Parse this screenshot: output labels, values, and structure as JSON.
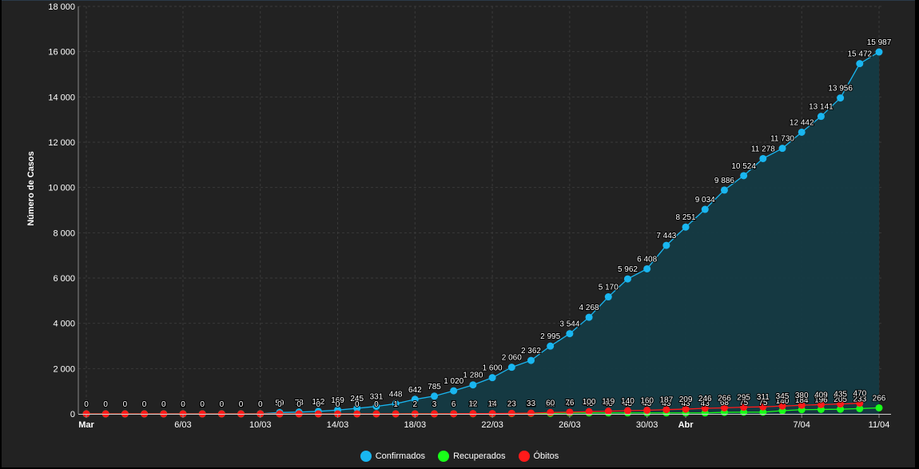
{
  "colors": {
    "background": "#222222",
    "grid": "#3a3a3a",
    "axis_text": "#ffffff",
    "confirmados": "#19b6f0",
    "recuperados": "#19ff19",
    "obitos": "#ff1a1a",
    "area_fill": "#153b44"
  },
  "legend": [
    {
      "name": "Confirmados",
      "color": "#19b6f0"
    },
    {
      "name": "Recuperados",
      "color": "#19ff19"
    },
    {
      "name": "Óbitos",
      "color": "#ff1a1a"
    }
  ],
  "chart_data": {
    "type": "line",
    "ylabel": "Número de Casos",
    "xlabel": "",
    "ylim": [
      0,
      18000
    ],
    "yticks": [
      0,
      2000,
      4000,
      6000,
      8000,
      10000,
      12000,
      14000,
      16000,
      18000
    ],
    "ytick_labels": [
      "0",
      "2 000",
      "4 000",
      "6 000",
      "8 000",
      "10 000",
      "12 000",
      "14 000",
      "16 000",
      "18 000"
    ],
    "x_start": "2020-03-01",
    "x_end": "2020-04-11",
    "xtick_labels": [
      {
        "date": "2020-03-01",
        "label": "Mar",
        "bold": true
      },
      {
        "date": "2020-03-06",
        "label": "6/03",
        "bold": false
      },
      {
        "date": "2020-03-10",
        "label": "10/03",
        "bold": false
      },
      {
        "date": "2020-03-14",
        "label": "14/03",
        "bold": false
      },
      {
        "date": "2020-03-18",
        "label": "18/03",
        "bold": false
      },
      {
        "date": "2020-03-22",
        "label": "22/03",
        "bold": false
      },
      {
        "date": "2020-03-26",
        "label": "26/03",
        "bold": false
      },
      {
        "date": "2020-03-30",
        "label": "30/03",
        "bold": false
      },
      {
        "date": "2020-04-01",
        "label": "Abr",
        "bold": true
      },
      {
        "date": "2020-04-07",
        "label": "7/04",
        "bold": false
      },
      {
        "date": "2020-04-11",
        "label": "11/04",
        "bold": false
      }
    ],
    "grid": true,
    "legend_position": "bottom",
    "series": [
      {
        "name": "Confirmados",
        "color": "#19b6f0",
        "points": [
          {
            "x": "2020-03-01",
            "y": 0,
            "label": "0"
          },
          {
            "x": "2020-03-02",
            "y": 0,
            "label": "0"
          },
          {
            "x": "2020-03-03",
            "y": 0,
            "label": "0"
          },
          {
            "x": "2020-03-04",
            "y": 0,
            "label": "0"
          },
          {
            "x": "2020-03-05",
            "y": 2,
            "label": "2"
          },
          {
            "x": "2020-03-06",
            "y": 2,
            "label": "2"
          },
          {
            "x": "2020-03-07",
            "y": 2,
            "label": "2"
          },
          {
            "x": "2020-03-08",
            "y": 3,
            "label": "3"
          },
          {
            "x": "2020-03-09",
            "y": 4,
            "label": "4"
          },
          {
            "x": "2020-03-10",
            "y": 5,
            "label": "5"
          },
          {
            "x": "2020-03-11",
            "y": 59,
            "label": "59"
          },
          {
            "x": "2020-03-12",
            "y": 78,
            "label": "78"
          },
          {
            "x": "2020-03-13",
            "y": 112,
            "label": "112"
          },
          {
            "x": "2020-03-14",
            "y": 169,
            "label": "169"
          },
          {
            "x": "2020-03-15",
            "y": 245,
            "label": "245"
          },
          {
            "x": "2020-03-16",
            "y": 331,
            "label": "331"
          },
          {
            "x": "2020-03-17",
            "y": 448,
            "label": "448"
          },
          {
            "x": "2020-03-18",
            "y": 642,
            "label": "642"
          },
          {
            "x": "2020-03-19",
            "y": 785,
            "label": "785"
          },
          {
            "x": "2020-03-20",
            "y": 1020,
            "label": "1 020"
          },
          {
            "x": "2020-03-21",
            "y": 1280,
            "label": "1 280"
          },
          {
            "x": "2020-03-22",
            "y": 1600,
            "label": "1 600"
          },
          {
            "x": "2020-03-23",
            "y": 2060,
            "label": "2 060"
          },
          {
            "x": "2020-03-24",
            "y": 2362,
            "label": "2 362"
          },
          {
            "x": "2020-03-25",
            "y": 2995,
            "label": "2 995"
          },
          {
            "x": "2020-03-26",
            "y": 3544,
            "label": "3 544"
          },
          {
            "x": "2020-03-27",
            "y": 4268,
            "label": "4 268"
          },
          {
            "x": "2020-03-28",
            "y": 5170,
            "label": "5 170"
          },
          {
            "x": "2020-03-29",
            "y": 5962,
            "label": "5 962"
          },
          {
            "x": "2020-03-30",
            "y": 6408,
            "label": "6 408"
          },
          {
            "x": "2020-03-31",
            "y": 7443,
            "label": "7 443"
          },
          {
            "x": "2020-04-01",
            "y": 8251,
            "label": "8 251"
          },
          {
            "x": "2020-04-02",
            "y": 9034,
            "label": "9 034"
          },
          {
            "x": "2020-04-03",
            "y": 9886,
            "label": "9 886"
          },
          {
            "x": "2020-04-04",
            "y": 10524,
            "label": "10 524"
          },
          {
            "x": "2020-04-05",
            "y": 11278,
            "label": "11 278"
          },
          {
            "x": "2020-04-06",
            "y": 11730,
            "label": "11 730"
          },
          {
            "x": "2020-04-07",
            "y": 12442,
            "label": "12 442"
          },
          {
            "x": "2020-04-08",
            "y": 13141,
            "label": "13 141"
          },
          {
            "x": "2020-04-09",
            "y": 13956,
            "label": "13 956"
          },
          {
            "x": "2020-04-10",
            "y": 15472,
            "label": "15 472"
          },
          {
            "x": "2020-04-11",
            "y": 15987,
            "label": "15 987"
          }
        ]
      },
      {
        "name": "Recuperados",
        "color": "#19ff19",
        "points": [
          {
            "x": "2020-03-01",
            "y": 0,
            "label": "0"
          },
          {
            "x": "2020-03-02",
            "y": 0,
            "label": "0"
          },
          {
            "x": "2020-03-03",
            "y": 0,
            "label": "0"
          },
          {
            "x": "2020-03-04",
            "y": 0,
            "label": "0"
          },
          {
            "x": "2020-03-05",
            "y": 0,
            "label": "0"
          },
          {
            "x": "2020-03-06",
            "y": 0,
            "label": "0"
          },
          {
            "x": "2020-03-07",
            "y": 0,
            "label": "0"
          },
          {
            "x": "2020-03-08",
            "y": 0,
            "label": "0"
          },
          {
            "x": "2020-03-09",
            "y": 0,
            "label": "0"
          },
          {
            "x": "2020-03-10",
            "y": 0,
            "label": "0"
          },
          {
            "x": "2020-03-11",
            "y": 0,
            "label": "0"
          },
          {
            "x": "2020-03-12",
            "y": 0,
            "label": "0"
          },
          {
            "x": "2020-03-13",
            "y": 0,
            "label": "0"
          },
          {
            "x": "2020-03-14",
            "y": 0,
            "label": "0"
          },
          {
            "x": "2020-03-15",
            "y": 0,
            "label": "0"
          },
          {
            "x": "2020-03-16",
            "y": 0,
            "label": "0"
          },
          {
            "x": "2020-03-17",
            "y": 1,
            "label": "1"
          },
          {
            "x": "2020-03-18",
            "y": 2,
            "label": "2"
          },
          {
            "x": "2020-03-19",
            "y": 3,
            "label": "3"
          },
          {
            "x": "2020-03-20",
            "y": 5,
            "label": "5"
          },
          {
            "x": "2020-03-21",
            "y": 5,
            "label": "5"
          },
          {
            "x": "2020-03-22",
            "y": 5,
            "label": "5"
          },
          {
            "x": "2020-03-23",
            "y": 14,
            "label": "14"
          },
          {
            "x": "2020-03-24",
            "y": 22,
            "label": "22"
          },
          {
            "x": "2020-03-25",
            "y": 22,
            "label": "22"
          },
          {
            "x": "2020-03-26",
            "y": 43,
            "label": "43"
          },
          {
            "x": "2020-03-27",
            "y": 43,
            "label": "43"
          },
          {
            "x": "2020-03-28",
            "y": 43,
            "label": "43"
          },
          {
            "x": "2020-03-29",
            "y": 43,
            "label": "43"
          },
          {
            "x": "2020-03-30",
            "y": 43,
            "label": "43"
          },
          {
            "x": "2020-03-31",
            "y": 43,
            "label": "43"
          },
          {
            "x": "2020-04-01",
            "y": 43,
            "label": "43"
          },
          {
            "x": "2020-04-02",
            "y": 43,
            "label": "43"
          },
          {
            "x": "2020-04-03",
            "y": 68,
            "label": "68"
          },
          {
            "x": "2020-04-04",
            "y": 75,
            "label": "75"
          },
          {
            "x": "2020-04-05",
            "y": 75,
            "label": "75"
          },
          {
            "x": "2020-04-06",
            "y": 140,
            "label": "140"
          },
          {
            "x": "2020-04-07",
            "y": 184,
            "label": "184"
          },
          {
            "x": "2020-04-08",
            "y": 196,
            "label": "196"
          },
          {
            "x": "2020-04-09",
            "y": 205,
            "label": "205"
          },
          {
            "x": "2020-04-10",
            "y": 233,
            "label": "233"
          },
          {
            "x": "2020-04-11",
            "y": 266,
            "label": "266"
          }
        ]
      },
      {
        "name": "Óbitos",
        "color": "#ff1a1a",
        "points": [
          {
            "x": "2020-03-01",
            "y": 0,
            "label": "0"
          },
          {
            "x": "2020-03-02",
            "y": 0,
            "label": "0"
          },
          {
            "x": "2020-03-03",
            "y": 0,
            "label": "0"
          },
          {
            "x": "2020-03-04",
            "y": 0,
            "label": "0"
          },
          {
            "x": "2020-03-05",
            "y": 0,
            "label": "0"
          },
          {
            "x": "2020-03-06",
            "y": 0,
            "label": "0"
          },
          {
            "x": "2020-03-07",
            "y": 0,
            "label": "0"
          },
          {
            "x": "2020-03-08",
            "y": 0,
            "label": "0"
          },
          {
            "x": "2020-03-09",
            "y": 0,
            "label": "0"
          },
          {
            "x": "2020-03-10",
            "y": 0,
            "label": "0"
          },
          {
            "x": "2020-03-11",
            "y": 0,
            "label": "0"
          },
          {
            "x": "2020-03-12",
            "y": 0,
            "label": "0"
          },
          {
            "x": "2020-03-13",
            "y": 0,
            "label": "0"
          },
          {
            "x": "2020-03-14",
            "y": 0,
            "label": "0"
          },
          {
            "x": "2020-03-15",
            "y": 0,
            "label": "0"
          },
          {
            "x": "2020-03-16",
            "y": 0,
            "label": "0"
          },
          {
            "x": "2020-03-17",
            "y": 1,
            "label": "1"
          },
          {
            "x": "2020-03-18",
            "y": 2,
            "label": "2"
          },
          {
            "x": "2020-03-19",
            "y": 3,
            "label": "3"
          },
          {
            "x": "2020-03-20",
            "y": 6,
            "label": "6"
          },
          {
            "x": "2020-03-21",
            "y": 12,
            "label": "12"
          },
          {
            "x": "2020-03-22",
            "y": 14,
            "label": "14"
          },
          {
            "x": "2020-03-23",
            "y": 23,
            "label": "23"
          },
          {
            "x": "2020-03-24",
            "y": 33,
            "label": "33"
          },
          {
            "x": "2020-03-25",
            "y": 60,
            "label": "60"
          },
          {
            "x": "2020-03-26",
            "y": 76,
            "label": "76"
          },
          {
            "x": "2020-03-27",
            "y": 100,
            "label": "100"
          },
          {
            "x": "2020-03-28",
            "y": 119,
            "label": "119"
          },
          {
            "x": "2020-03-29",
            "y": 140,
            "label": "140"
          },
          {
            "x": "2020-03-30",
            "y": 160,
            "label": "160"
          },
          {
            "x": "2020-03-31",
            "y": 187,
            "label": "187"
          },
          {
            "x": "2020-04-01",
            "y": 209,
            "label": "209"
          },
          {
            "x": "2020-04-02",
            "y": 246,
            "label": "246"
          },
          {
            "x": "2020-04-03",
            "y": 266,
            "label": "266"
          },
          {
            "x": "2020-04-04",
            "y": 295,
            "label": "295"
          },
          {
            "x": "2020-04-05",
            "y": 311,
            "label": "311"
          },
          {
            "x": "2020-04-06",
            "y": 345,
            "label": "345"
          },
          {
            "x": "2020-04-07",
            "y": 380,
            "label": "380"
          },
          {
            "x": "2020-04-08",
            "y": 409,
            "label": "409"
          },
          {
            "x": "2020-04-09",
            "y": 435,
            "label": "435"
          },
          {
            "x": "2020-04-10",
            "y": 470,
            "label": "470"
          }
        ]
      }
    ]
  }
}
